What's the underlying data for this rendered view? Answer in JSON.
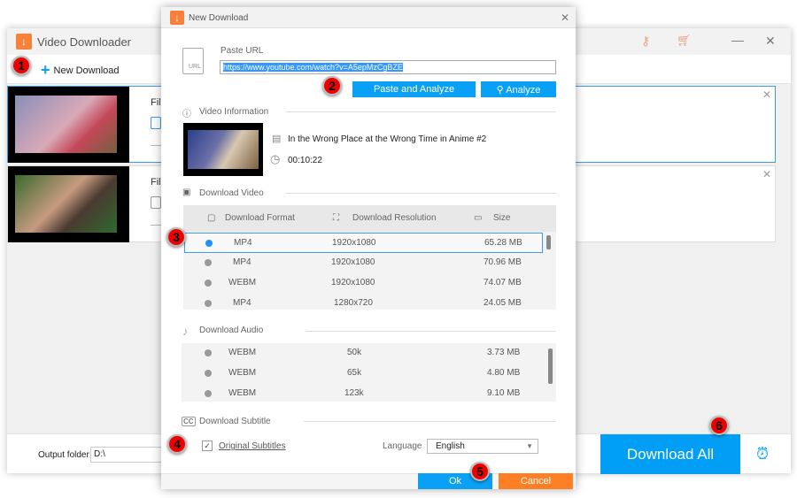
{
  "main": {
    "title": "Video Downloader",
    "new_download": "New Download",
    "file_label": "File",
    "output_label": "Output folder:",
    "output_value": "D:\\",
    "download_all": "Download All"
  },
  "dialog": {
    "title": "New Download",
    "paste_url_label": "Paste URL",
    "url_value": "https://www.youtube.com/watch?v=A5epMzCgBZE",
    "paste_analyze": "Paste and Analyze",
    "analyze": "Analyze",
    "video_info_label": "Video Information",
    "video_title": "In the Wrong Place at the Wrong Time in Anime #2",
    "duration": "00:10:22",
    "download_video_label": "Download Video",
    "headers": {
      "format": "Download Format",
      "resolution": "Download Resolution",
      "size": "Size"
    },
    "video_rows": [
      {
        "format": "MP4",
        "resolution": "1920x1080",
        "size": "65.28 MB",
        "selected": true
      },
      {
        "format": "MP4",
        "resolution": "1920x1080",
        "size": "70.96 MB",
        "selected": false
      },
      {
        "format": "WEBM",
        "resolution": "1920x1080",
        "size": "74.07 MB",
        "selected": false
      },
      {
        "format": "MP4",
        "resolution": "1280x720",
        "size": "24.05 MB",
        "selected": false
      }
    ],
    "download_audio_label": "Download Audio",
    "audio_rows": [
      {
        "format": "WEBM",
        "bitrate": "50k",
        "size": "3.73 MB"
      },
      {
        "format": "WEBM",
        "bitrate": "65k",
        "size": "4.80 MB"
      },
      {
        "format": "WEBM",
        "bitrate": "123k",
        "size": "9.10 MB"
      }
    ],
    "download_subtitle_label": "Download Subtitle",
    "original_subtitles": "Original Subtitles",
    "original_subtitles_checked": true,
    "language_label": "Language",
    "language_value": "English",
    "ok": "Ok",
    "cancel": "Cancel"
  },
  "badges": [
    "1",
    "2",
    "3",
    "4",
    "5",
    "6"
  ],
  "colors": {
    "accent": "#009ef5",
    "cancel": "#ff7f24",
    "badge": "#e00000",
    "logo": "#f7803a"
  }
}
